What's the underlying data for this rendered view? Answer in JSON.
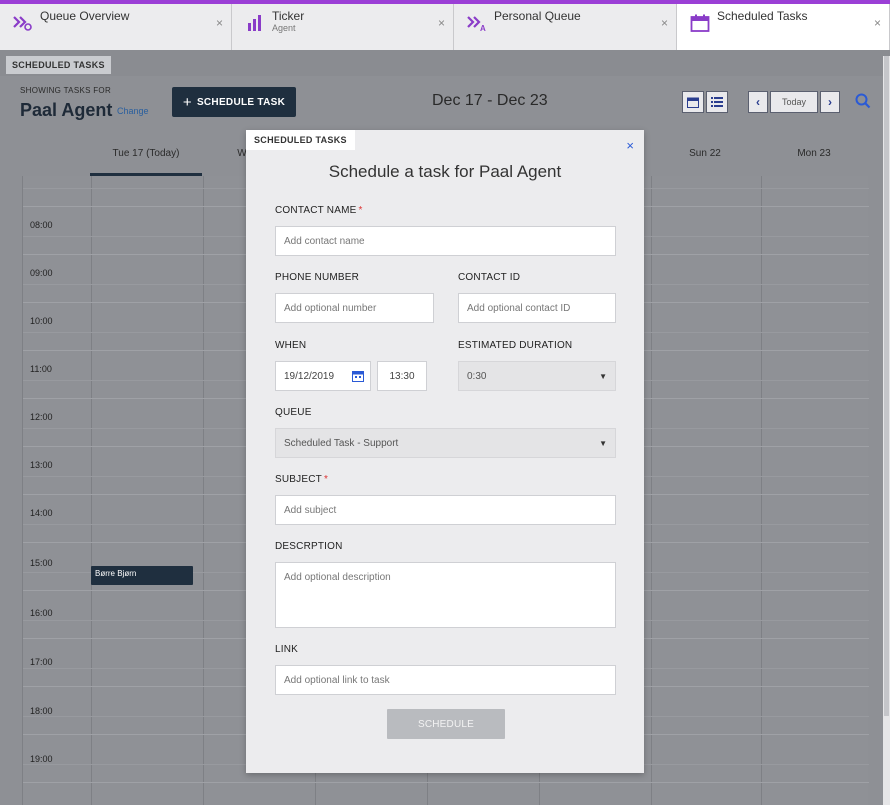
{
  "tabs": [
    {
      "label": "Queue Overview",
      "sub": "",
      "icon": "queue-icon",
      "close": "×"
    },
    {
      "label": "Ticker",
      "sub": "Agent",
      "icon": "bar-chart-icon",
      "close": "×"
    },
    {
      "label": "Personal Queue",
      "sub": "",
      "icon": "personal-queue-icon",
      "close": "×"
    },
    {
      "label": "Scheduled Tasks",
      "sub": "",
      "icon": "calendar-icon",
      "close": "×"
    }
  ],
  "header": {
    "section": "SCHEDULED TASKS",
    "showing_label": "SHOWING TASKS FOR",
    "agent_name": "Paal Agent",
    "change": "Change",
    "schedule_button": "SCHEDULE TASK",
    "date_range": "Dec 17 - Dec 23",
    "today": "Today"
  },
  "calendar": {
    "days": [
      "Tue 17 (Today)",
      "W",
      "Sun 22",
      "Mon 23"
    ],
    "times": [
      "08:00",
      "09:00",
      "10:00",
      "11:00",
      "12:00",
      "13:00",
      "14:00",
      "15:00",
      "16:00",
      "17:00",
      "18:00",
      "19:00"
    ],
    "event": {
      "title": "Børre Bjørn",
      "start": "15:00",
      "day": "Tue 17 (Today)"
    }
  },
  "modal": {
    "tag": "SCHEDULED TASKS",
    "close": "×",
    "title": "Schedule a task for Paal Agent",
    "contact_name": {
      "label": "CONTACT NAME",
      "required": "*",
      "placeholder": "Add contact name"
    },
    "phone_number": {
      "label": "PHONE NUMBER",
      "placeholder": "Add optional number"
    },
    "contact_id": {
      "label": "CONTACT ID",
      "placeholder": "Add optional contact ID"
    },
    "when": {
      "label": "WHEN",
      "date": "19/12/2019",
      "time": "13:30"
    },
    "estimated_duration": {
      "label": "ESTIMATED DURATION",
      "value": "0:30"
    },
    "queue": {
      "label": "QUEUE",
      "value": "Scheduled Task - Support"
    },
    "subject": {
      "label": "SUBJECT",
      "required": "*",
      "placeholder": "Add subject"
    },
    "description": {
      "label": "DESCRPTION",
      "placeholder": "Add optional description"
    },
    "link": {
      "label": "LINK",
      "placeholder": "Add optional link to task"
    },
    "submit": "SCHEDULE"
  },
  "colors": {
    "accent": "#9b3fd6",
    "dark_button": "#1f2f3f",
    "link": "#2a5f9e",
    "required": "#d33333"
  }
}
